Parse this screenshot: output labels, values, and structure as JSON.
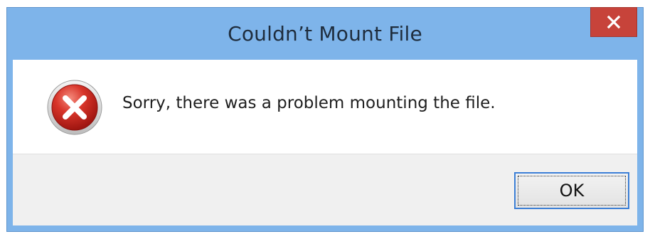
{
  "dialog": {
    "title": "Couldn’t Mount File",
    "message": "Sorry, there was a problem mounting the file.",
    "ok_label": "OK",
    "close_label": "×",
    "icon": "error-icon"
  },
  "colors": {
    "frame": "#7eb4ea",
    "close_button": "#c7433a",
    "footer": "#f0f0f0",
    "focus_border": "#3c7fd6"
  }
}
